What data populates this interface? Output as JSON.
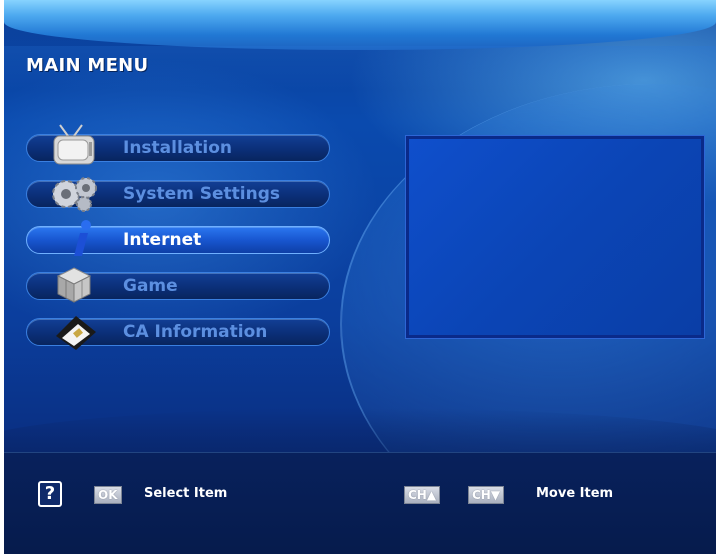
{
  "header": {
    "title": "MAIN MENU"
  },
  "menu": {
    "items": [
      {
        "label": "Installation",
        "icon": "tv-icon",
        "selected": false
      },
      {
        "label": "System Settings",
        "icon": "gears-icon",
        "selected": false
      },
      {
        "label": "Internet",
        "icon": "info-icon",
        "selected": true
      },
      {
        "label": "Game",
        "icon": "cube-icon",
        "selected": false
      },
      {
        "label": "CA Information",
        "icon": "card-icon",
        "selected": false
      }
    ]
  },
  "footer": {
    "help_glyph": "?",
    "ok_key": "OK",
    "select_hint": "Select Item",
    "ch_up_key": "CH▲",
    "ch_down_key": "CH▼",
    "move_hint": "Move Item"
  },
  "colors": {
    "background": "#0b3e9d",
    "menu_selected": "#1856d0",
    "menu_label": "#5c8fe0",
    "preview_border": "#0a2a8a"
  }
}
